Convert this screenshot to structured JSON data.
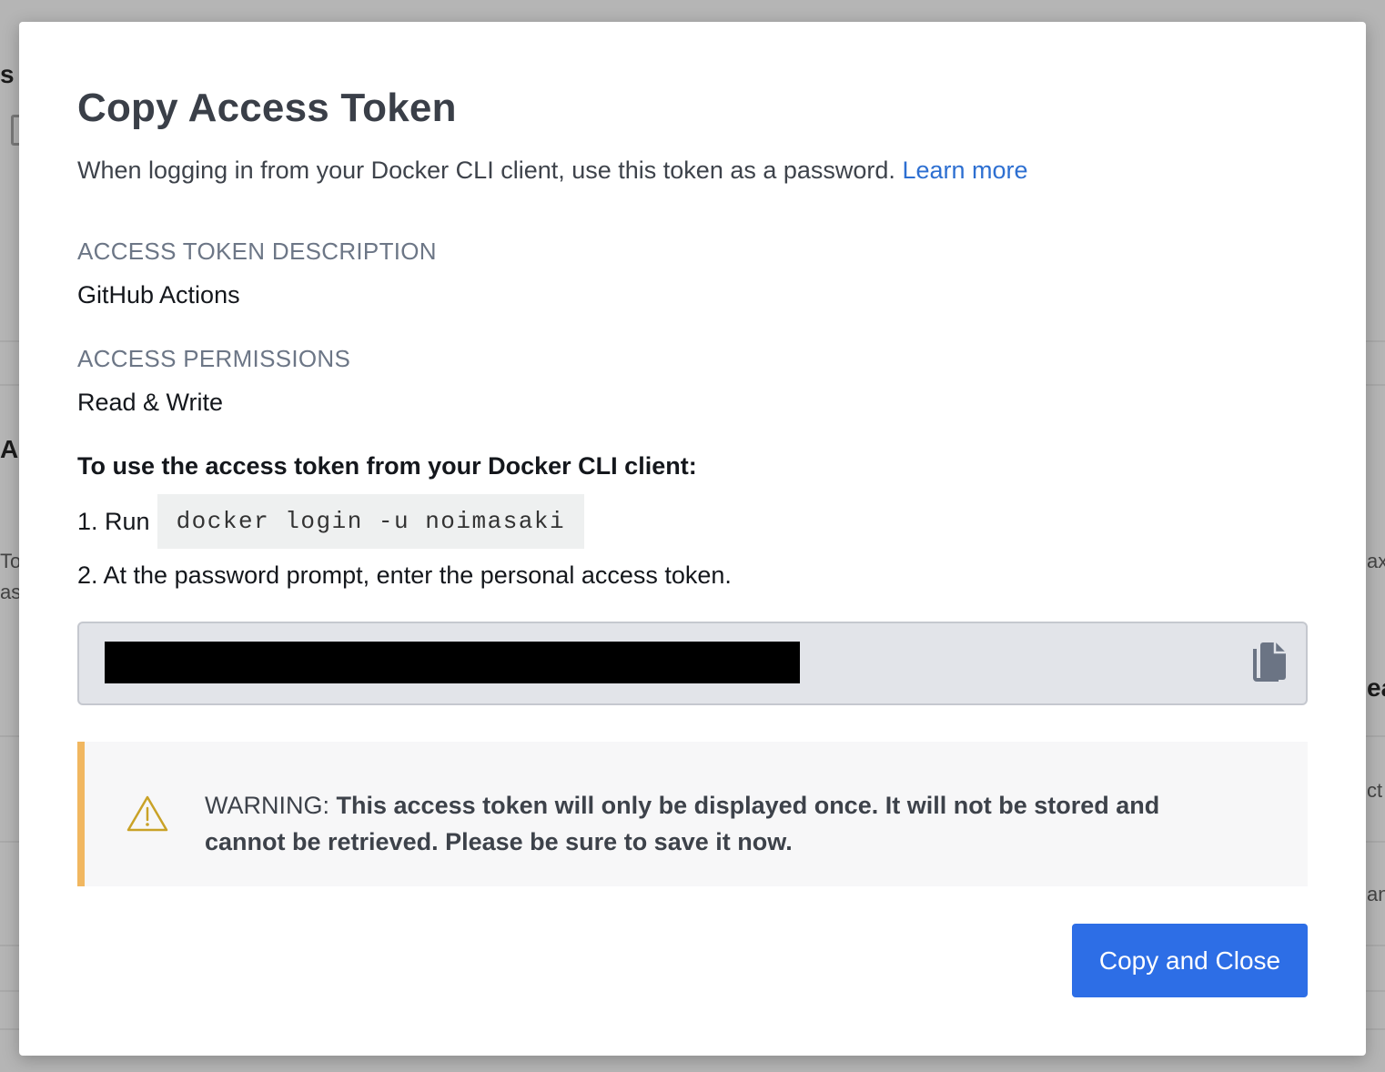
{
  "background": {
    "fragments": [
      "s",
      "A",
      "To",
      "as",
      "axi",
      "ea",
      "ct",
      "an"
    ]
  },
  "modal": {
    "title": "Copy Access Token",
    "subtitle": "When logging in from your Docker CLI client, use this token as a password.",
    "learn_more": "Learn more",
    "description_label": "ACCESS TOKEN DESCRIPTION",
    "description_value": "GitHub Actions",
    "permissions_label": "ACCESS PERMISSIONS",
    "permissions_value": "Read & Write",
    "instructions_heading": "To use the access token from your Docker CLI client:",
    "step1_prefix": "1. Run",
    "step1_code": "docker login -u noimasaki",
    "step2": "2. At the password prompt, enter the personal access token.",
    "token_icon": "copy-icon",
    "warning": {
      "icon": "warning-triangle-icon",
      "prefix": "WARNING:",
      "text": "This access token will only be displayed once. It will not be stored and cannot be retrieved. Please be sure to save it now."
    },
    "primary_button": "Copy and Close"
  },
  "colors": {
    "accent": "#2d6ee6",
    "link": "#2d6fd1",
    "warning_border": "#f1b760",
    "warning_icon": "#c9a227"
  }
}
